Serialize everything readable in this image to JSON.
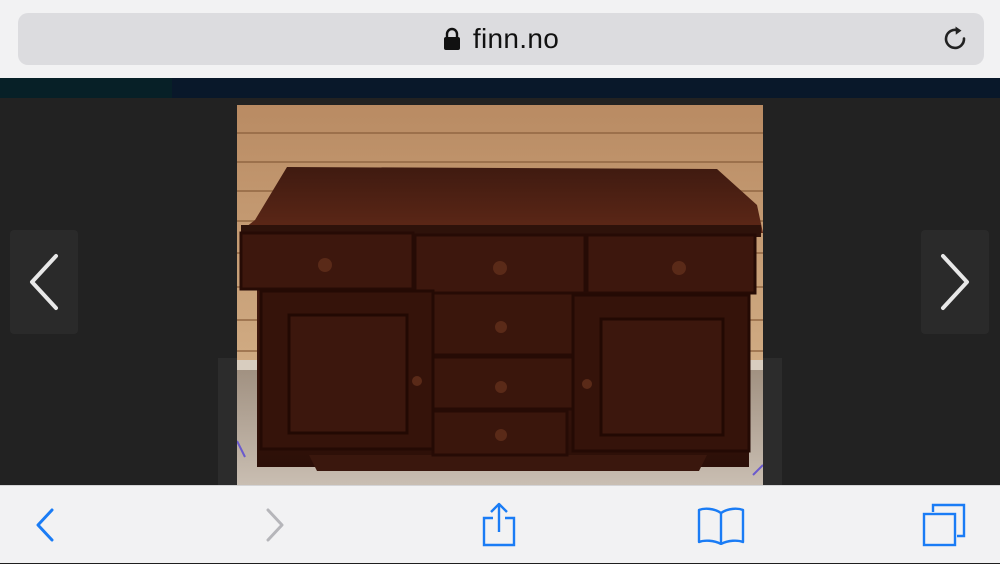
{
  "browser": {
    "url_domain": "finn.no",
    "icons": {
      "lock": "lock-icon",
      "reload": "reload-icon"
    }
  },
  "gallery": {
    "image_description_icon": "photo",
    "prev_icon": "chevron-left-icon",
    "next_icon": "chevron-right-icon"
  },
  "toolbar": {
    "back_icon": "back-icon",
    "forward_icon": "forward-icon",
    "share_icon": "share-icon",
    "bookmarks_icon": "bookmarks-icon",
    "tabs_icon": "tabs-icon",
    "accent_color": "#1a7cf5",
    "disabled_color": "#b6b6ba"
  }
}
